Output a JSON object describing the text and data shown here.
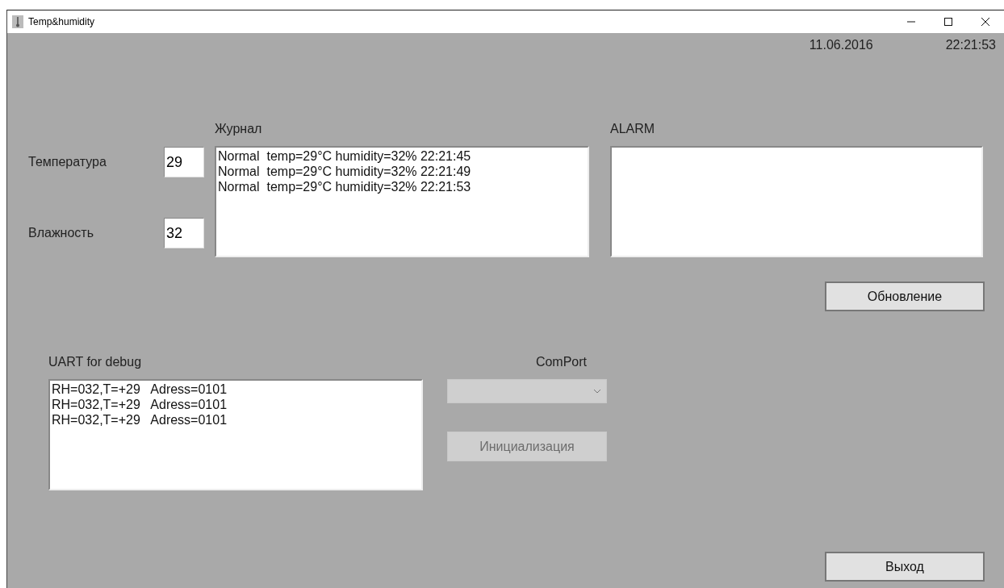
{
  "window": {
    "title": "Temp&humidity"
  },
  "date": "11.06.2016",
  "time": "22:21:53",
  "readings": [
    {
      "label": "Температура",
      "value": "29"
    },
    {
      "label": "Влажность",
      "value": "32"
    }
  ],
  "journal": {
    "label": "Журнал",
    "lines": [
      "Normal  temp=29°C humidity=32% 22:21:45",
      "Normal  temp=29°C humidity=32% 22:21:49",
      "Normal  temp=29°C humidity=32% 22:21:53"
    ]
  },
  "alarm": {
    "label": "ALARM"
  },
  "update_button": "Обновление",
  "uart": {
    "label": "UART for debug",
    "lines": [
      "RH=032,T=+29   Adress=0101",
      "RH=032,T=+29   Adress=0101",
      "RH=032,T=+29   Adress=0101"
    ]
  },
  "comport": {
    "label": "ComPort",
    "disabled": true
  },
  "init_button": {
    "label": "Инициализация",
    "disabled": true
  },
  "exit_button": "Выход"
}
